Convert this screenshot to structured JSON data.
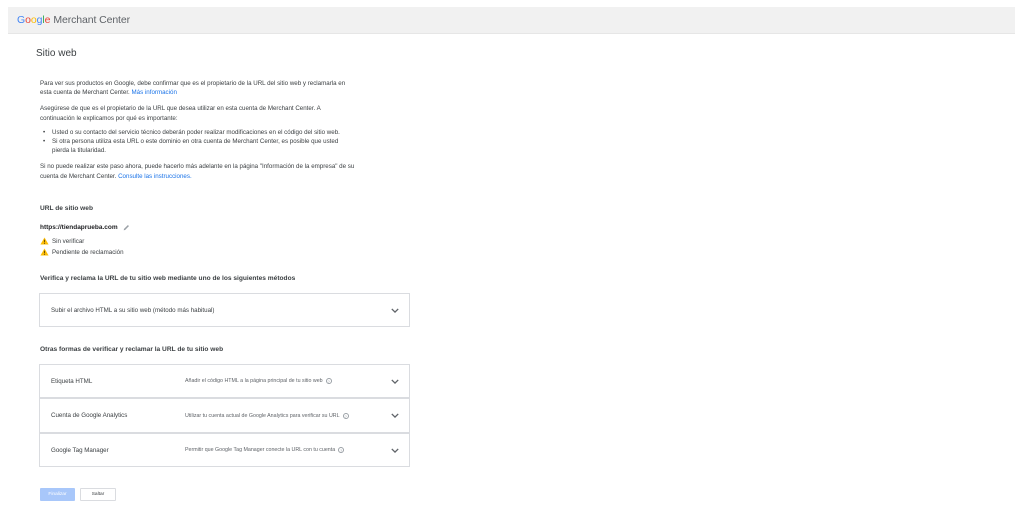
{
  "header": {
    "logo_google": [
      "G",
      "o",
      "o",
      "g",
      "l",
      "e"
    ],
    "logo_product": "Merchant Center"
  },
  "page": {
    "title": "Sitio web"
  },
  "intro": {
    "p1_text": "Para ver sus productos en Google, debe confirmar que es el propietario de la URL del sitio web y reclamarla en esta cuenta de Merchant Center.",
    "p1_link": "Más información",
    "p2_text": "Asegúrese de que es el propietario de la URL que desea utilizar en esta cuenta de Merchant Center. A continuación le explicamos por qué es importante:",
    "bullets": [
      "Usted o su contacto del servicio técnico deberán poder realizar modificaciones en el código del sitio web.",
      "Si otra persona utiliza esta URL o este dominio en otra cuenta de Merchant Center, es posible que usted pierda la titularidad."
    ],
    "p3_text": "Si no puede realizar este paso ahora, puede hacerlo más adelante en la página \"Información de la empresa\" de su cuenta de Merchant Center.",
    "p3_link": "Consulte las instrucciones."
  },
  "website": {
    "section_label": "URL de sitio web",
    "url": "https://tiendaprueba.com",
    "statuses": [
      "Sin verificar",
      "Pendiente de reclamación"
    ],
    "status_color": "#fbbc05"
  },
  "verify": {
    "heading": "Verifica y reclama la URL de tu sitio web mediante uno de los siguientes métodos",
    "primary_method": "Subir el archivo HTML a su sitio web (método más habitual)"
  },
  "other": {
    "heading": "Otras formas de verificar y reclamar la URL de tu sitio web",
    "methods": [
      {
        "label": "Etiqueta HTML",
        "desc": "Añadir el código HTML a la página principal de tu sitio web"
      },
      {
        "label": "Cuenta de Google Analytics",
        "desc": "Utilizar tu cuenta actual de Google Analytics para verificar su URL"
      },
      {
        "label": "Google Tag Manager",
        "desc": "Permitir que Google Tag Manager conecte la URL con tu cuenta"
      }
    ]
  },
  "actions": {
    "finish_label": "Finalizar",
    "skip_label": "Saltar",
    "primary_color": "#a8c7fa"
  },
  "icons": {
    "help_glyph": "?"
  }
}
